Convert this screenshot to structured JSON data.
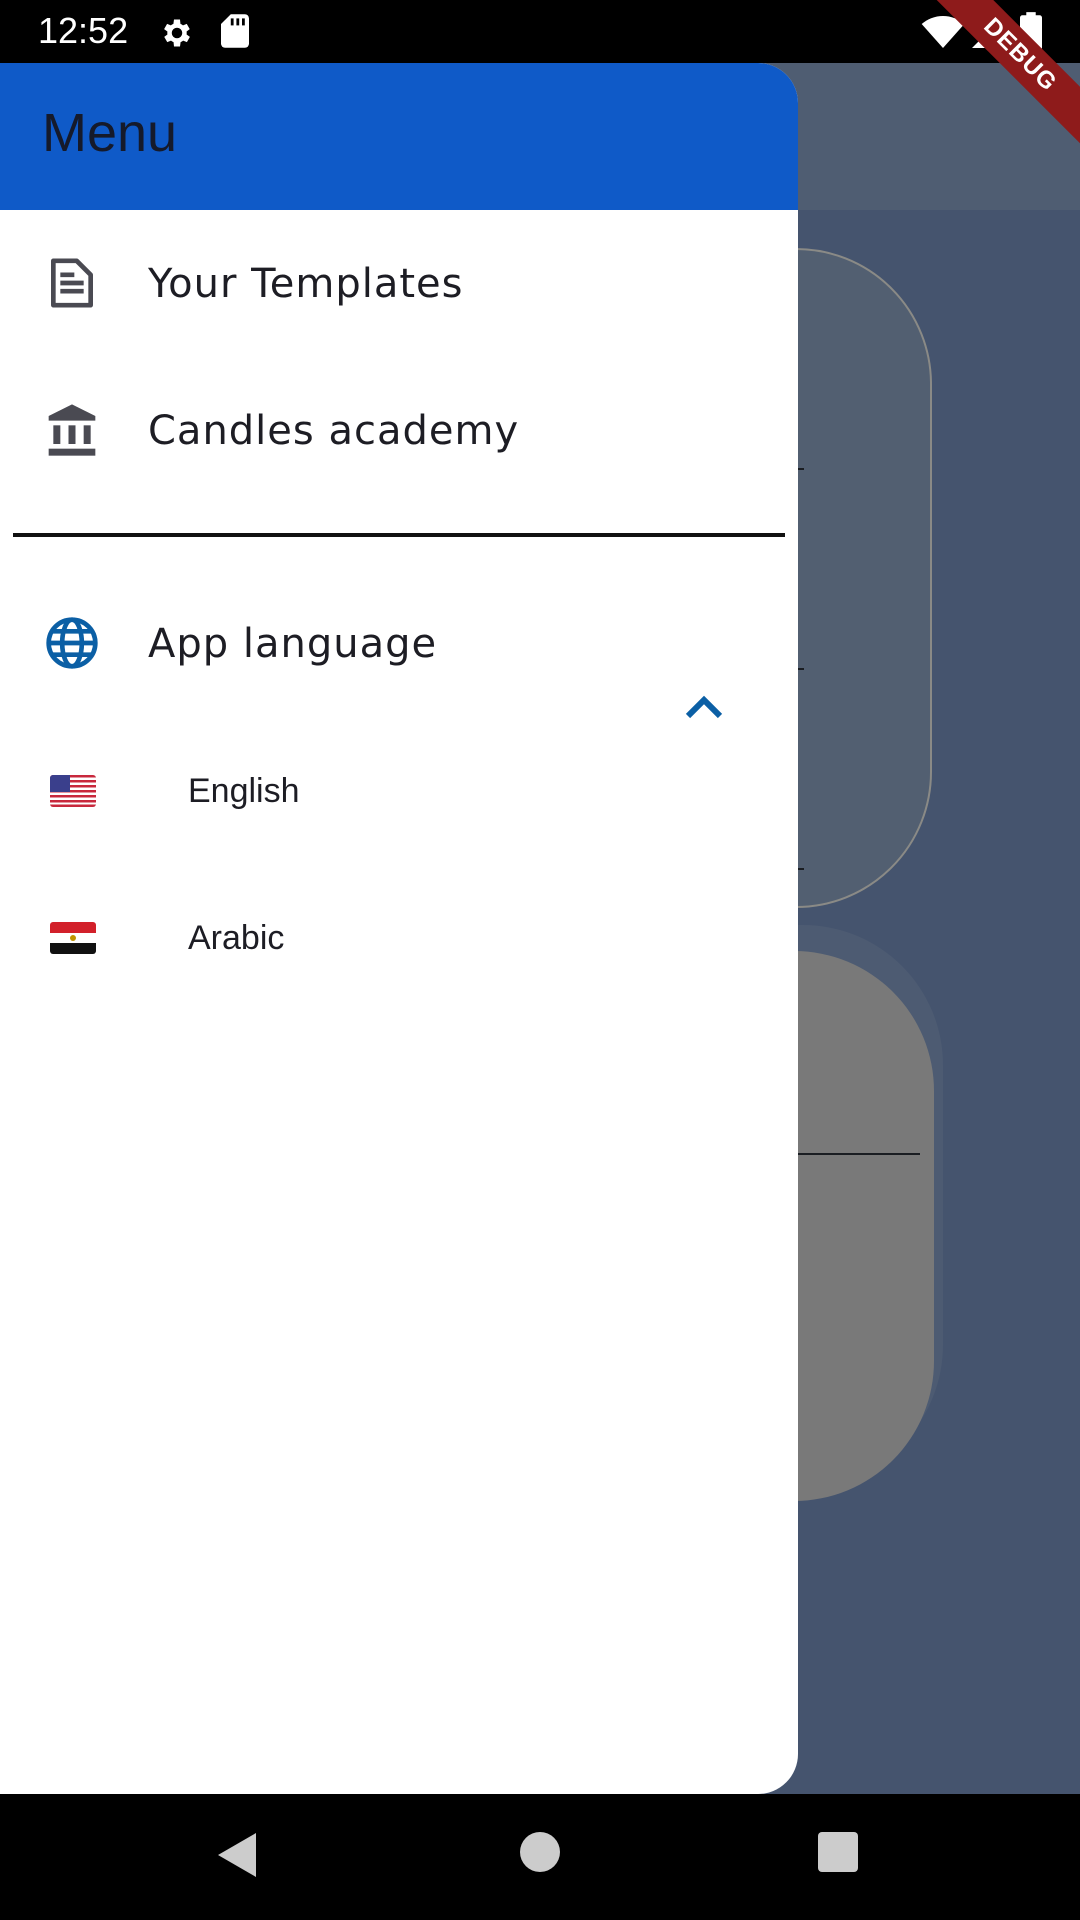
{
  "status_bar": {
    "time": "12:52",
    "icons": [
      "gear-icon",
      "sd-card-icon",
      "wifi-icon",
      "signal-icon",
      "battery-icon"
    ]
  },
  "debug_banner": {
    "label": "DEBUG"
  },
  "drawer": {
    "title": "Menu",
    "header_color": "#0f5ac8",
    "items": [
      {
        "icon": "document-icon",
        "label": "Your Templates"
      },
      {
        "icon": "bank-icon",
        "label": "Candles academy"
      }
    ],
    "language_section": {
      "icon": "globe-icon",
      "label": "App language",
      "expanded": true,
      "accent_color": "#0b5fa5",
      "options": [
        {
          "flag": "us-flag-icon",
          "label": "English"
        },
        {
          "flag": "egypt-flag-icon",
          "label": "Arabic"
        }
      ]
    }
  },
  "nav_bar": {
    "buttons": [
      "back-icon",
      "home-icon",
      "recents-icon"
    ]
  }
}
